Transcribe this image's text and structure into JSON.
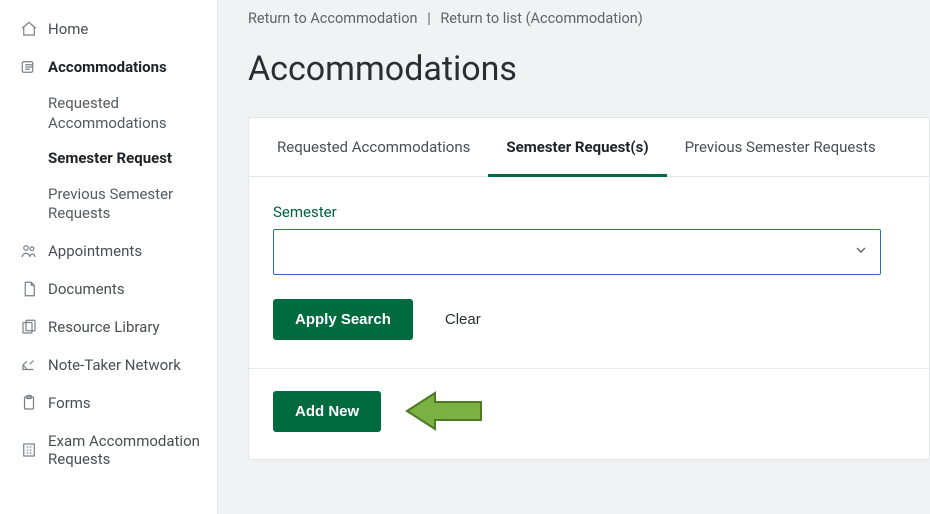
{
  "sidebar": {
    "items": [
      {
        "label": "Home"
      },
      {
        "label": "Accommodations"
      },
      {
        "label": "Appointments"
      },
      {
        "label": "Documents"
      },
      {
        "label": "Resource Library"
      },
      {
        "label": "Note-Taker Network"
      },
      {
        "label": "Forms"
      },
      {
        "label": "Exam Accommodation Requests"
      }
    ],
    "subitems": [
      {
        "label": "Requested Accommodations"
      },
      {
        "label": "Semester Request"
      },
      {
        "label": "Previous Semester Requests"
      }
    ]
  },
  "breadcrumb": {
    "a": "Return to Accommodation",
    "sep": "|",
    "b": "Return to list (Accommodation)"
  },
  "page": {
    "title": "Accommodations"
  },
  "tabs": [
    {
      "label": "Requested Accommodations"
    },
    {
      "label": "Semester Request(s)"
    },
    {
      "label": "Previous Semester Requests"
    }
  ],
  "filter": {
    "label": "Semester",
    "value": "",
    "apply": "Apply Search",
    "clear": "Clear"
  },
  "actions": {
    "add_new": "Add New"
  }
}
